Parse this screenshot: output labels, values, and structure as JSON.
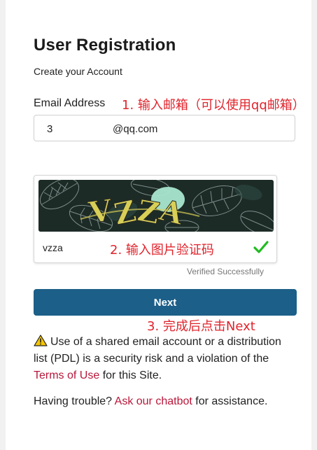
{
  "form": {
    "title": "User Registration",
    "subtitle": "Create your Account",
    "email_label": "Email Address",
    "email_value": "3",
    "email_suffix": "@qq.com"
  },
  "annotations": {
    "step1": "1. 输入邮箱（可以使用qq邮箱）",
    "step2": "2. 输入图片验证码",
    "step3": "3. 完成后点击Next"
  },
  "captcha": {
    "image_text": "VZZA",
    "input_value": "vzza",
    "status": "Verified Successfully",
    "status_icon": "check-icon",
    "status_color": "#22bb22"
  },
  "next_button": {
    "label": "Next",
    "color": "#1c5f88"
  },
  "warning": {
    "icon": "warning-icon",
    "text_before": "Use of a shared email account or a distribution list (PDL) is a security risk and a violation of the ",
    "link_text": "Terms of Use",
    "text_after": " for this Site."
  },
  "help": {
    "text_before": "Having trouble? ",
    "link_text": "Ask our chatbot",
    "text_after": " for assistance."
  },
  "colors": {
    "annotation": "#e0242c",
    "link": "#b8173a"
  }
}
